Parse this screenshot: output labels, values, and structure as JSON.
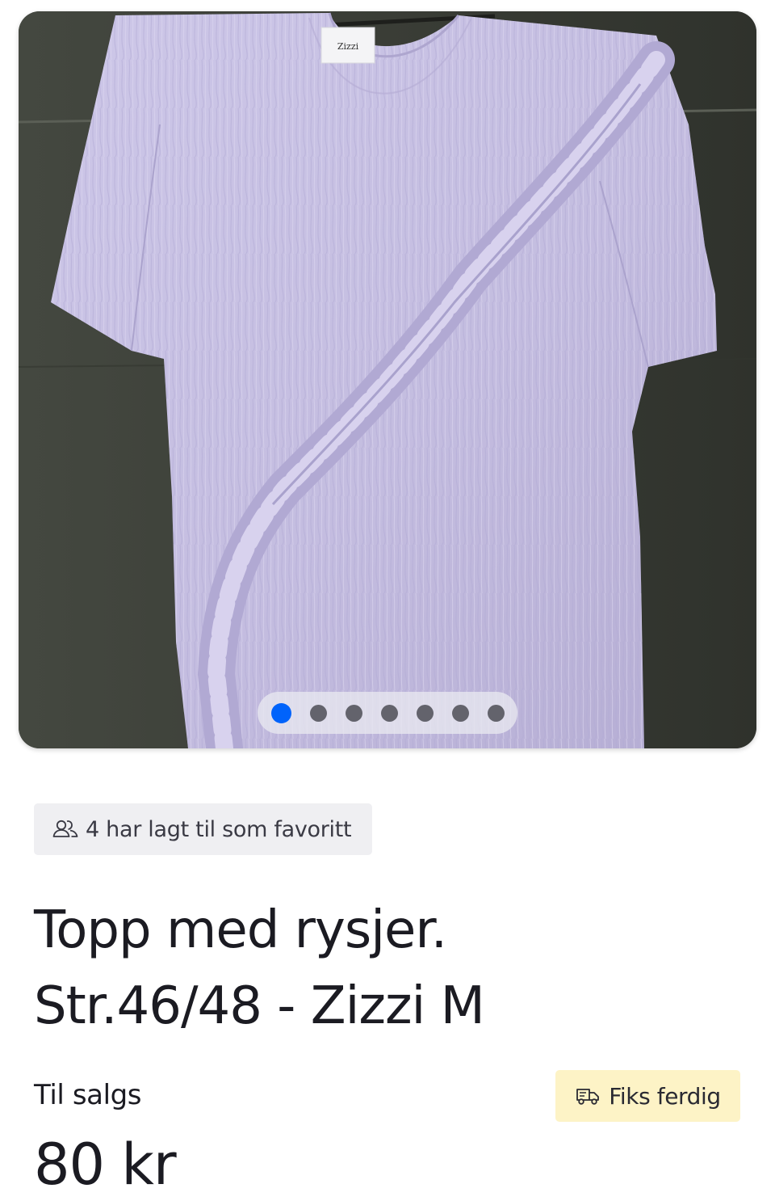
{
  "gallery": {
    "image_alt": "Topp med rysjer",
    "brand_tag": "Zizzi",
    "total_images": 7,
    "active_index": 0,
    "colors": {
      "active_dot": "#0063fb",
      "inactive_dot": "#63636c",
      "garment": "#c9c3e4",
      "background_wall": "#3d403a"
    }
  },
  "favorites": {
    "icon": "users-icon",
    "text": "4 har lagt til som favoritt"
  },
  "listing": {
    "title": "Topp med rysjer. Str.46/48 - Zizzi M",
    "status_label": "Til salgs",
    "price": "80 kr"
  },
  "shipping": {
    "icon": "truck-icon",
    "label": "Fiks ferdig",
    "badge_color": "#fdf3c6"
  }
}
